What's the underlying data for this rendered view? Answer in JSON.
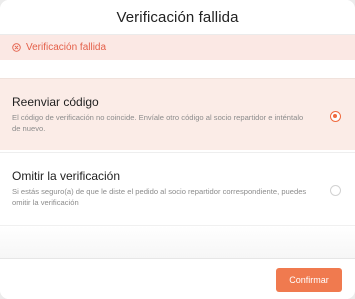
{
  "dialog": {
    "title": "Verificación fallida"
  },
  "banner": {
    "icon": "x-circle-icon",
    "text": "Verificación fallida",
    "color": "#e4604a",
    "background": "#fbe8e4"
  },
  "options": [
    {
      "title": "Reenviar código",
      "description": "El código de verificación no coincide. Envíale otro código al socio repartidor e inténtalo de nuevo.",
      "selected": true
    },
    {
      "title": "Omitir la verificación",
      "description": "Si estás seguro(a) de que le diste el pedido al socio repartidor correspondiente, puedes omitir la verificación",
      "selected": false
    }
  ],
  "footer": {
    "confirm_label": "Confirmar",
    "accent_color": "#f07a4f"
  }
}
